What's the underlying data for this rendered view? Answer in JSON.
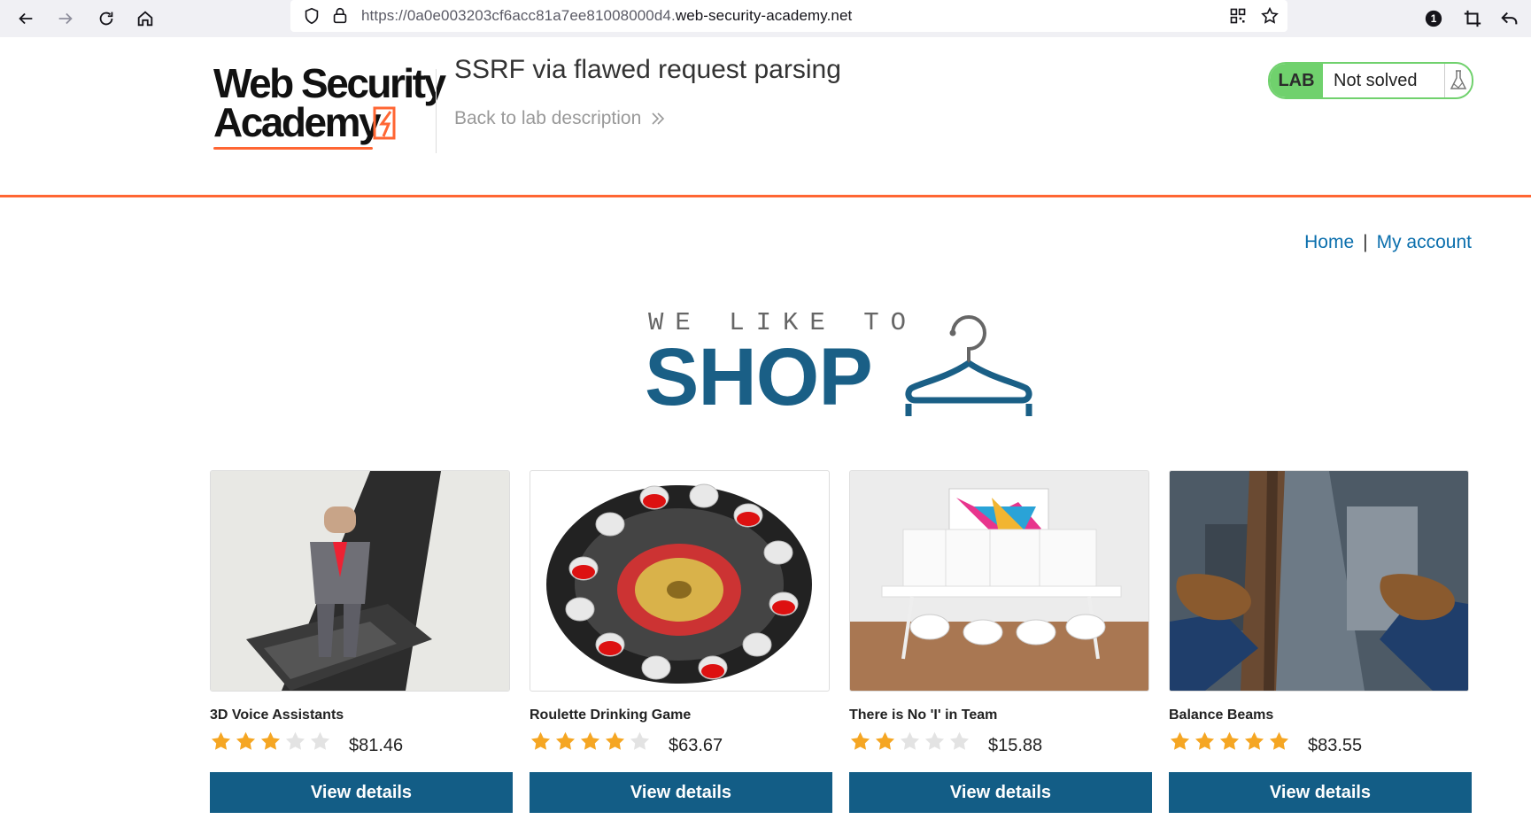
{
  "browser": {
    "url_prefix": "https://0a0e003203cf6acc81a7ee81008000d4.",
    "url_domain": "web-security-academy.net",
    "notification_count": "1"
  },
  "header": {
    "logo_line1": "Web Security",
    "logo_line2": "Academy",
    "lab_title": "SSRF via flawed request parsing",
    "back_link": "Back to lab description",
    "lab_badge": "LAB",
    "lab_status": "Not solved"
  },
  "nav": {
    "home": "Home",
    "separator": "|",
    "my_account": "My account"
  },
  "banner": {
    "line1": "WE LIKE TO",
    "line2": "SHOP"
  },
  "products": [
    {
      "name": "3D Voice Assistants",
      "rating": 3,
      "price": "$81.46",
      "button": "View details"
    },
    {
      "name": "Roulette Drinking Game",
      "rating": 4,
      "price": "$63.67",
      "button": "View details"
    },
    {
      "name": "There is No 'I' in Team",
      "rating": 2,
      "price": "$15.88",
      "button": "View details"
    },
    {
      "name": "Balance Beams",
      "rating": 5,
      "price": "$83.55",
      "button": "View details"
    }
  ],
  "colors": {
    "accent_orange": "#ff6633",
    "button_blue": "#135d86",
    "link_blue": "#0b6fad",
    "lab_green": "#70d16d",
    "star_gold": "#f5a623",
    "star_grey": "#e3e3e3"
  }
}
